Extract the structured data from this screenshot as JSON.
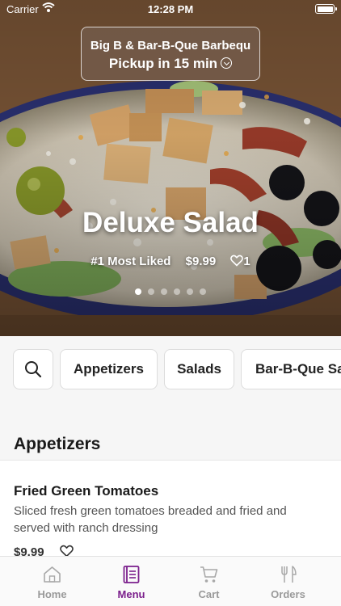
{
  "status_bar": {
    "carrier": "Carrier",
    "time": "12:28 PM"
  },
  "pickup": {
    "store_name": "Big B & Bar-B-Que Barbequ",
    "pickup_text": "Pickup in 15 min"
  },
  "featured": {
    "title": "Deluxe Salad",
    "rank": "#1 Most Liked",
    "price": "$9.99",
    "likes": "1",
    "carousel_pages": 6,
    "carousel_active": 1
  },
  "categories": [
    "Appetizers",
    "Salads",
    "Bar-B-Que Sa"
  ],
  "section": {
    "title": "Appetizers"
  },
  "items": [
    {
      "name": "Fried Green Tomatoes",
      "description": "Sliced fresh green tomatoes breaded and fried and served with ranch dressing",
      "price": "$9.99"
    }
  ],
  "tabs": [
    {
      "label": "Home",
      "icon": "home-icon"
    },
    {
      "label": "Menu",
      "icon": "menu-book-icon",
      "active": true
    },
    {
      "label": "Cart",
      "icon": "cart-icon"
    },
    {
      "label": "Orders",
      "icon": "fork-knife-icon"
    }
  ],
  "colors": {
    "accent": "#7b1f8c",
    "tab_inactive": "#9a9a9a",
    "background": "#f6f6f6"
  }
}
